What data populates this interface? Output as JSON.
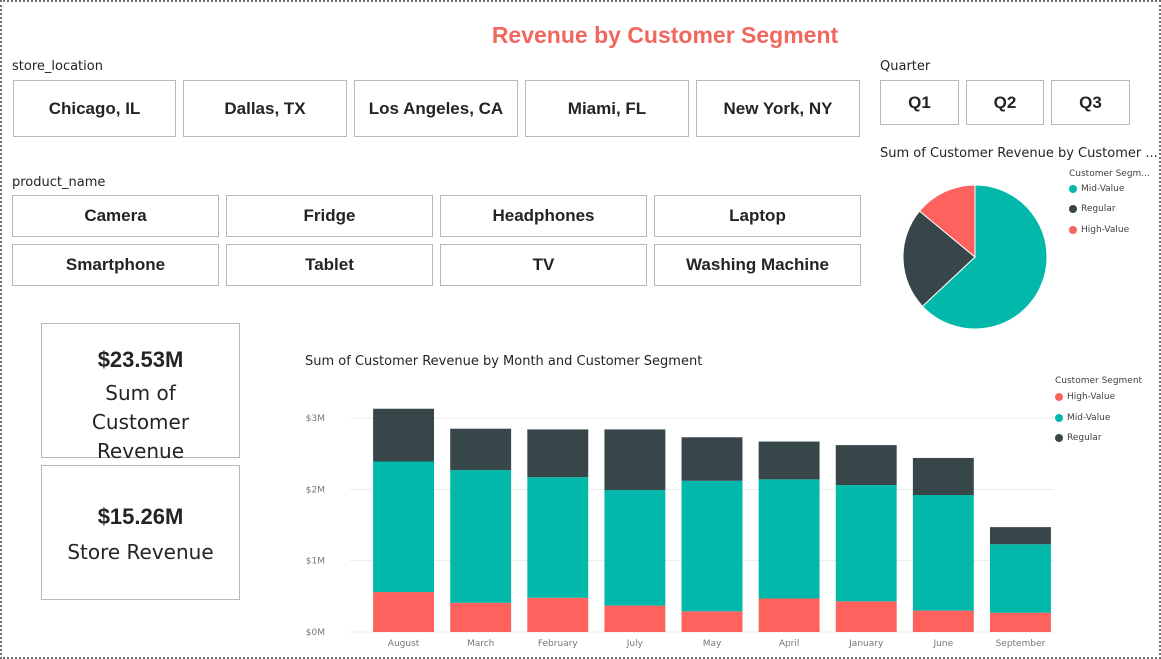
{
  "report": {
    "title": "Revenue by Customer Segment"
  },
  "slicers": {
    "store_location": {
      "label": "store_location",
      "items": [
        "Chicago, IL",
        "Dallas, TX",
        "Los Angeles, CA",
        "Miami, FL",
        "New York, NY"
      ]
    },
    "product_name": {
      "label": "product_name",
      "items": [
        "Camera",
        "Fridge",
        "Headphones",
        "Laptop",
        "Smartphone",
        "Tablet",
        "TV",
        "Washing Machine"
      ]
    },
    "quarter": {
      "label": "Quarter",
      "items": [
        "Q1",
        "Q2",
        "Q3"
      ]
    }
  },
  "cards": [
    {
      "value": "$23.53M",
      "label": "Sum of Customer Revenue"
    },
    {
      "value": "$15.26M",
      "label": "Store Revenue"
    }
  ],
  "colors": {
    "high_value": "#fd625e",
    "mid_value": "#01b8aa",
    "regular": "#374649",
    "title": "#f0675f"
  },
  "pie": {
    "title": "Sum of Customer Revenue by Customer ...",
    "legend_title": "Customer Segm...",
    "legend": [
      "Mid-Value",
      "Regular",
      "High-Value"
    ]
  },
  "bar": {
    "title": "Sum of Customer Revenue by Month and Customer Segment",
    "legend_title": "Customer Segment",
    "legend": [
      "High-Value",
      "Mid-Value",
      "Regular"
    ]
  },
  "chart_data": [
    {
      "type": "pie",
      "title": "Sum of Customer Revenue by Customer ...",
      "legend_title": "Customer Segm...",
      "categories": [
        "Mid-Value",
        "Regular",
        "High-Value"
      ],
      "values": [
        0.63,
        0.23,
        0.14
      ],
      "colors": [
        "#01b8aa",
        "#374649",
        "#fd625e"
      ]
    },
    {
      "type": "bar",
      "stacked": true,
      "title": "Sum of Customer Revenue by Month and Customer Segment",
      "legend_title": "Customer Segment",
      "legend_position": "right",
      "categories": [
        "August",
        "March",
        "February",
        "July",
        "May",
        "April",
        "January",
        "June",
        "September"
      ],
      "ylim": [
        0,
        3
      ],
      "yticks": [
        "$0M",
        "$1M",
        "$2M",
        "$3M"
      ],
      "grid": true,
      "series": [
        {
          "name": "High-Value",
          "color": "#fd625e",
          "values": [
            0.56,
            0.41,
            0.48,
            0.37,
            0.29,
            0.47,
            0.43,
            0.3,
            0.27
          ]
        },
        {
          "name": "Mid-Value",
          "color": "#01b8aa",
          "values": [
            1.83,
            1.86,
            1.69,
            1.62,
            1.83,
            1.67,
            1.63,
            1.62,
            0.96
          ]
        },
        {
          "name": "Regular",
          "color": "#374649",
          "values": [
            0.74,
            0.58,
            0.67,
            0.85,
            0.61,
            0.53,
            0.56,
            0.52,
            0.24
          ]
        }
      ]
    }
  ]
}
